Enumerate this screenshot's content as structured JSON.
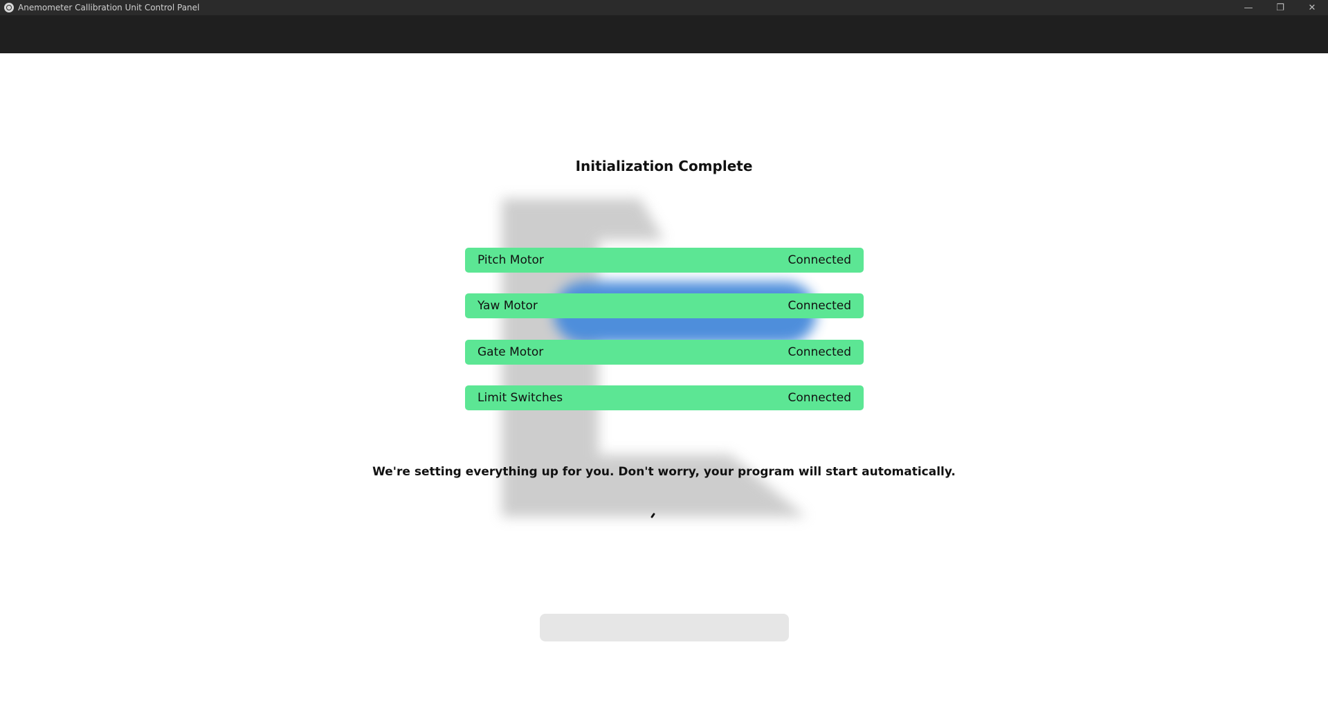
{
  "window": {
    "title": "Anemometer Callibration Unit Control Panel",
    "controls": {
      "minimize": "—",
      "restore": "❐",
      "close": "✕"
    }
  },
  "dialog": {
    "title": "Initialization Complete",
    "devices": [
      {
        "name": "Pitch Motor",
        "status": "Connected"
      },
      {
        "name": "Yaw Motor",
        "status": "Connected"
      },
      {
        "name": "Gate Motor",
        "status": "Connected"
      },
      {
        "name": "Limit Switches",
        "status": "Connected"
      }
    ],
    "message": "We're setting everything up for you. Don't worry, your program will start automatically."
  },
  "colors": {
    "status_connected": "#5ce694",
    "titlebar": "#2b2b2b",
    "toolbar": "#1f1f1f"
  },
  "icons": {
    "app": "app-globe-icon",
    "loading": "loading-spinner-icon"
  }
}
